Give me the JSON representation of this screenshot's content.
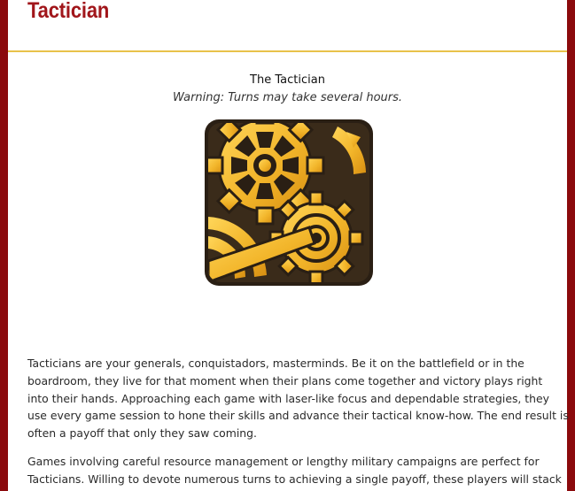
{
  "page": {
    "title": "Tactician"
  },
  "card": {
    "title": "The Tactician",
    "warning": "Warning: Turns may take several hours.",
    "icon": "gears-icon"
  },
  "body": {
    "paragraph1": [
      "Tacticians are your generals, conquistadors, masterminds. Be it on the battlefield or in the",
      "boardroom, they live for that moment when their plans come together and victory plays right",
      "into their hands. Approaching each game with laser-like focus and dependable strategies, they",
      "use every game session to hone their skills and advance their tactical know-how. The end result is",
      "often a payoff that only they saw coming."
    ],
    "paragraph2": [
      "Games involving careful resource management or lengthy military campaigns are perfect for",
      "Tacticians. Willing to devote numerous turns to achieving a single payoff, these players will stack"
    ]
  },
  "colors": {
    "frame": "#8b0a0d",
    "title": "#a1161b",
    "divider": "#e8c24a",
    "icon_gold": "#f2b52a",
    "icon_dark": "#2a1f14"
  }
}
